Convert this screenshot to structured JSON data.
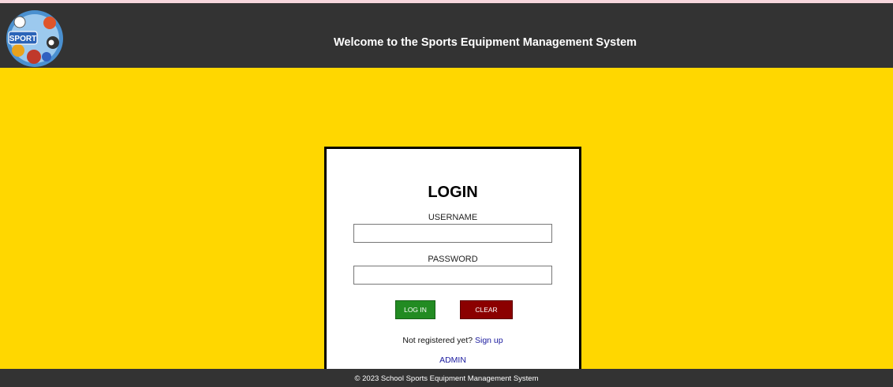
{
  "header": {
    "title": "Welcome to the Sports Equipment Management System",
    "logo_text": "SPORT"
  },
  "login": {
    "title": "LOGIN",
    "username_label": "USERNAME",
    "username_value": "",
    "password_label": "PASSWORD",
    "password_value": "",
    "login_button": "LOG IN",
    "clear_button": "CLEAR",
    "signup_prompt": "Not registered yet?",
    "signup_link": "Sign up",
    "admin_link": "ADMIN"
  },
  "footer": {
    "text": "© 2023 School Sports Equipment Management System"
  },
  "colors": {
    "header_bg": "#333333",
    "page_bg": "#ffd700",
    "login_button": "#228b22",
    "clear_button": "#8b0000",
    "link": "#1a1a9e"
  }
}
